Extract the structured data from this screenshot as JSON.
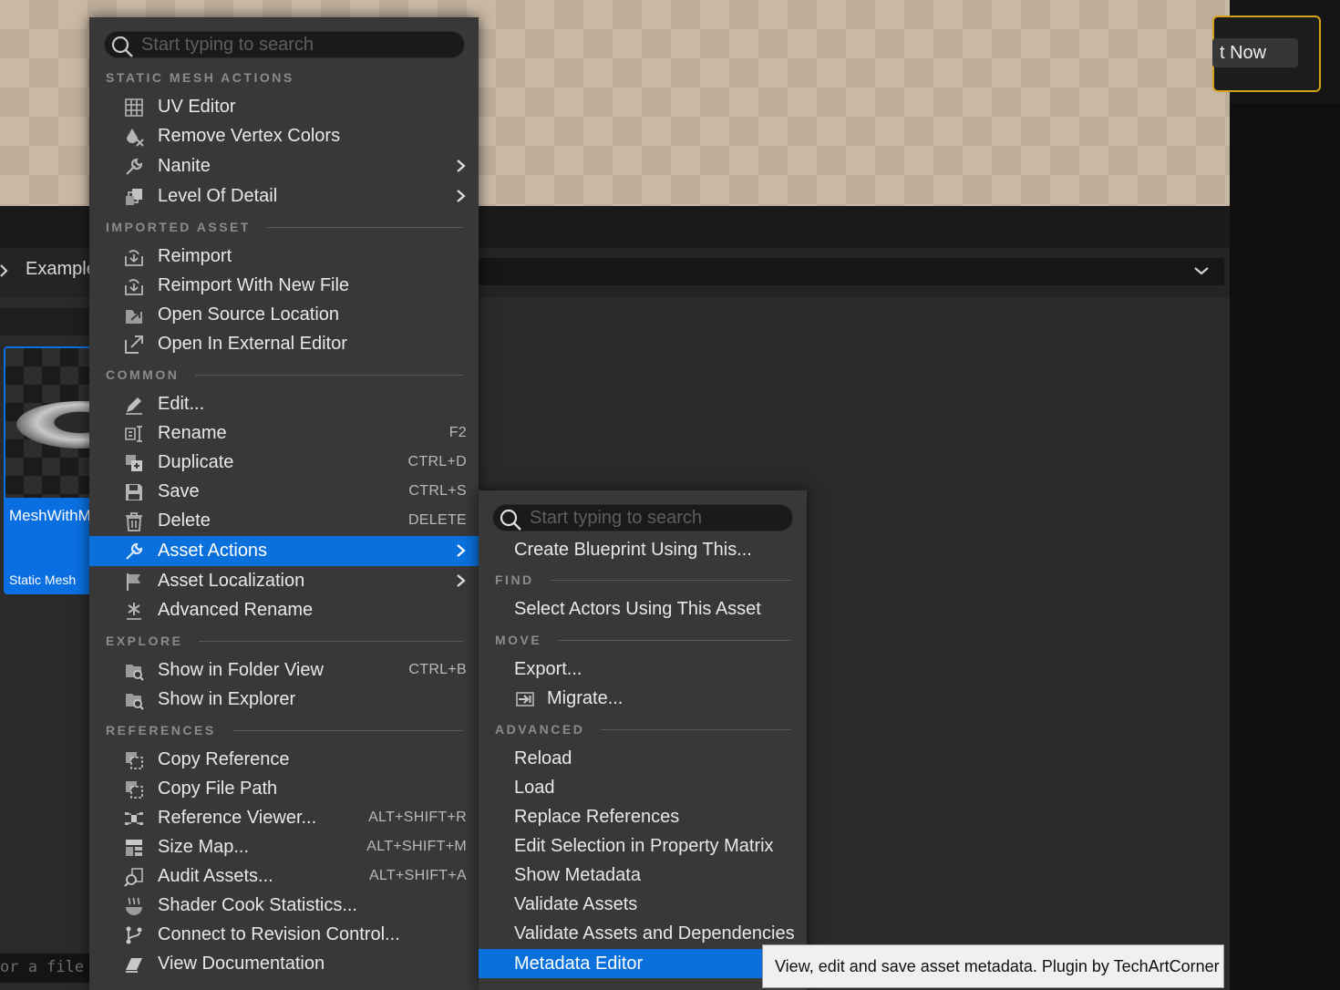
{
  "background": {
    "notification_button": "t Now",
    "breadcrumb": "Example",
    "asset_tile": {
      "name": "MeshWithM",
      "type": "Static Mesh"
    },
    "file_input_text": "or a file"
  },
  "main_menu": {
    "search_placeholder": "Start typing to search",
    "sections": {
      "static_mesh_actions": "STATIC MESH ACTIONS",
      "imported_asset": "IMPORTED ASSET",
      "common": "COMMON",
      "explore": "EXPLORE",
      "references": "REFERENCES"
    },
    "items": [
      {
        "label": "UV Editor",
        "icon": "uv-grid-icon"
      },
      {
        "label": "Remove Vertex Colors",
        "icon": "vertex-color-remove-icon"
      },
      {
        "label": "Nanite",
        "icon": "wrench-icon",
        "submenu": true
      },
      {
        "label": "Level Of Detail",
        "icon": "lod-icon",
        "submenu": true
      },
      {
        "label": "Reimport",
        "icon": "reimport-icon"
      },
      {
        "label": "Reimport With New File",
        "icon": "reimport-icon"
      },
      {
        "label": "Open Source Location",
        "icon": "open-folder-icon"
      },
      {
        "label": "Open In External Editor",
        "icon": "external-editor-icon"
      },
      {
        "label": "Edit...",
        "icon": "pencil-icon"
      },
      {
        "label": "Rename",
        "icon": "rename-icon",
        "shortcut": "F2"
      },
      {
        "label": "Duplicate",
        "icon": "duplicate-icon",
        "shortcut": "CTRL+D"
      },
      {
        "label": "Save",
        "icon": "save-icon",
        "shortcut": "CTRL+S"
      },
      {
        "label": "Delete",
        "icon": "trash-icon",
        "shortcut": "DELETE"
      },
      {
        "label": "Asset Actions",
        "icon": "wrench-icon",
        "submenu": true,
        "selected": true
      },
      {
        "label": "Asset Localization",
        "icon": "flag-icon",
        "submenu": true
      },
      {
        "label": "Advanced Rename",
        "icon": "asterisk-icon"
      },
      {
        "label": "Show in Folder View",
        "icon": "folder-search-icon",
        "shortcut": "CTRL+B"
      },
      {
        "label": "Show in Explorer",
        "icon": "folder-search-icon"
      },
      {
        "label": "Copy Reference",
        "icon": "copy-icon"
      },
      {
        "label": "Copy File Path",
        "icon": "copy-icon"
      },
      {
        "label": "Reference Viewer...",
        "icon": "reference-viewer-icon",
        "shortcut": "ALT+SHIFT+R"
      },
      {
        "label": "Size Map...",
        "icon": "size-map-icon",
        "shortcut": "ALT+SHIFT+M"
      },
      {
        "label": "Audit Assets...",
        "icon": "audit-icon",
        "shortcut": "ALT+SHIFT+A"
      },
      {
        "label": "Shader Cook Statistics...",
        "icon": "shader-cook-icon"
      },
      {
        "label": "Connect to Revision Control...",
        "icon": "branch-icon"
      },
      {
        "label": "View Documentation",
        "icon": "documentation-icon"
      }
    ]
  },
  "sub_menu": {
    "search_placeholder": "Start typing to search",
    "sections": {
      "find": "FIND",
      "move": "MOVE",
      "advanced": "ADVANCED"
    },
    "items": [
      {
        "label": "Create Blueprint Using This..."
      },
      {
        "label": "Select Actors Using This Asset"
      },
      {
        "label": "Export..."
      },
      {
        "label": "Migrate...",
        "icon": "migrate-icon"
      },
      {
        "label": "Reload"
      },
      {
        "label": "Load"
      },
      {
        "label": "Replace References"
      },
      {
        "label": "Edit Selection in Property Matrix"
      },
      {
        "label": "Show Metadata"
      },
      {
        "label": "Validate Assets"
      },
      {
        "label": "Validate Assets and Dependencies"
      },
      {
        "label": "Metadata Editor",
        "selected": true
      }
    ]
  },
  "tooltip": "View, edit and save asset metadata. Plugin by TechArtCorner",
  "colors": {
    "selection": "#0a70dc",
    "menu_bg": "#383838",
    "notification_border": "#d4a21b"
  }
}
